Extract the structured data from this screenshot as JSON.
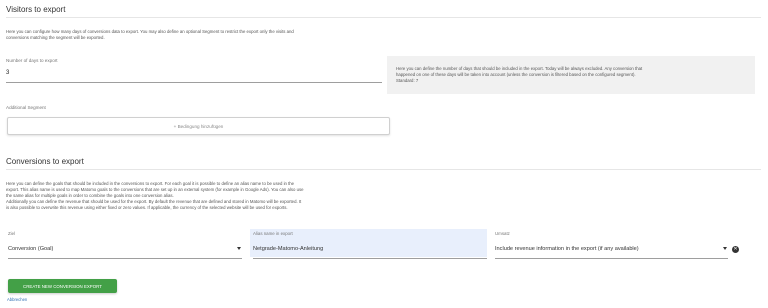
{
  "visitors": {
    "title": "Visitors to export",
    "description_line1": "Here you can configure how many days of conversions data to export. You may also define an optional Segment to restrict the export only the visits and",
    "description_line2": "conversions matching the segment will be exported.",
    "days_label": "Number of days to export",
    "days_value": "3",
    "help_line1": "Here you can define the number of days that should be included in the export. Today will be always excluded. Any conversion that",
    "help_line2": "happened on one of these days will be taken into account (unless the conversion is filtered based on the configured segment).",
    "help_line3": "Standard: 7",
    "segment_label": "Additional Segment",
    "add_condition_label": "+ Bedingung hinzufügen"
  },
  "conversions": {
    "title": "Conversions to export",
    "desc_lines": [
      "Here you can define the goals that should be included in the conversions to export. For each goal it is possible to define an alias name to be used in the",
      "export. This alias name is used to map Matomo goals to the conversions that are set up in an external system (for example in Google Ads). You can also use",
      "the same alias for multiple goals in order to combine the goals into one conversion alias.",
      "Additionally you can define the revenue that should be used for the export. By default the revenue that are defined and stored in Matomo will be exported. It",
      "is also possible to overwrite this revenue using either fixed or zero values. If applicable, the currency of the selected website will be used for exports."
    ],
    "goal_label": "Ziel",
    "goal_value": "Conversion (Goal)",
    "alias_label": "Alias name in export",
    "alias_value": "Netgrade-Matomo-Anleitung",
    "revenue_label": "Umsatz",
    "revenue_value": "Include revenue information in the export (if any available)",
    "create_button": "CREATE NEW CONVERSION EXPORT",
    "cancel_link": "Abbrechen"
  },
  "icons": {
    "delete": "remove-circle-icon",
    "dropdown": "caret-down-icon"
  }
}
